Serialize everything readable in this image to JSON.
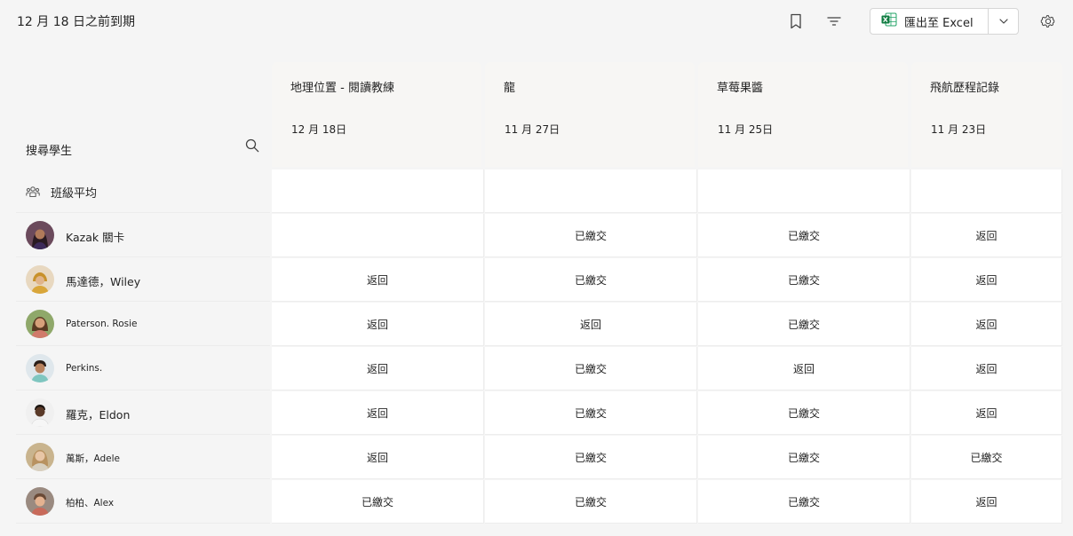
{
  "header": {
    "title": "12 月 18 日之前到期",
    "export_label": "匯出至 Excel"
  },
  "search": {
    "label": "搜尋學生"
  },
  "assignments": [
    {
      "name": "地理位置 - 閱讀教練",
      "date": "12 月 18日"
    },
    {
      "name": "龍",
      "date": "11 月 27日"
    },
    {
      "name": "草莓果醬",
      "date": "11 月 25日"
    },
    {
      "name": "飛航歷程記錄",
      "date": "11 月 23日"
    }
  ],
  "class_average": {
    "label": "班級平均",
    "values": [
      "",
      "",
      "",
      ""
    ]
  },
  "students": [
    {
      "name": "Kazak 關卡",
      "status": [
        "",
        "已繳交",
        "已繳交",
        "返回"
      ]
    },
    {
      "name": "馬達德，Wiley",
      "status": [
        "返回",
        "已繳交",
        "已繳交",
        "返回"
      ]
    },
    {
      "name": "Paterson. Rosie",
      "status": [
        "返回",
        "返回",
        "已繳交",
        "返回"
      ]
    },
    {
      "name": "Perkins.",
      "status": [
        "返回",
        "已繳交",
        "返回",
        "返回"
      ]
    },
    {
      "name": "羅克，Eldon",
      "status": [
        "返回",
        "已繳交",
        "已繳交",
        "返回"
      ]
    },
    {
      "name": "萬斯，Adele",
      "status": [
        "返回",
        "已繳交",
        "已繳交",
        "已繳交"
      ]
    },
    {
      "name": "柏柏、Alex",
      "status": [
        "已繳交",
        "已繳交",
        "已繳交",
        "返回"
      ]
    }
  ],
  "colors": {
    "excel_green": "#107c41",
    "page_bg": "#f5f5f5",
    "header_bg": "#f7f6f4"
  },
  "icons": [
    "bookmark-icon",
    "filter-icon",
    "excel-icon",
    "chevron-down-icon",
    "gear-icon",
    "search-icon",
    "people-icon"
  ]
}
